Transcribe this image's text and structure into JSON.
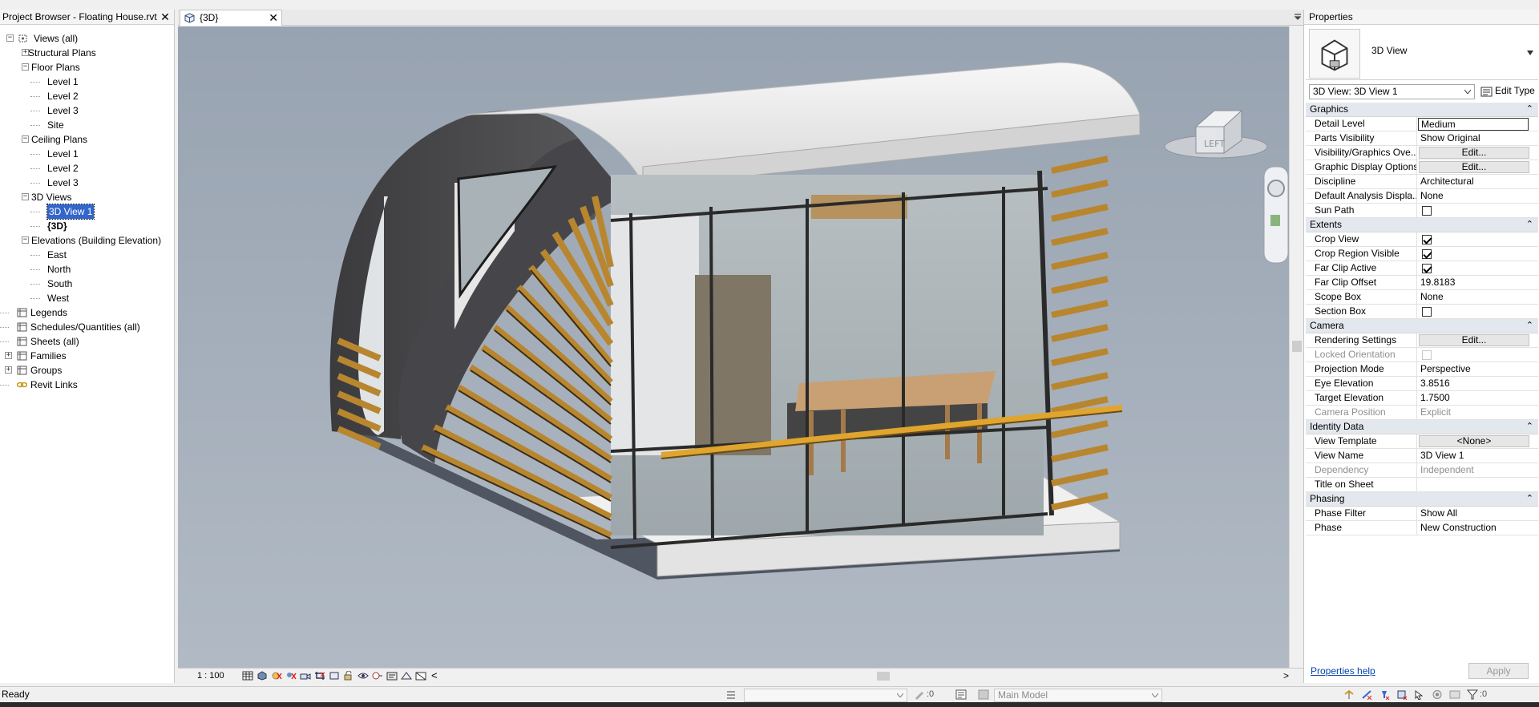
{
  "project_browser": {
    "title": "Project Browser - Floating House.rvt",
    "close": "✕",
    "items": [
      {
        "label": "Views (all)",
        "toggle": "−"
      },
      {
        "label": "Structural Plans",
        "toggle": "+"
      },
      {
        "label": "Floor Plans",
        "toggle": "−"
      },
      {
        "label": "Level 1"
      },
      {
        "label": "Level 2"
      },
      {
        "label": "Level 3"
      },
      {
        "label": "Site"
      },
      {
        "label": "Ceiling Plans",
        "toggle": "−"
      },
      {
        "label": "Level 1"
      },
      {
        "label": "Level 2"
      },
      {
        "label": "Level 3"
      },
      {
        "label": "3D Views",
        "toggle": "−"
      },
      {
        "label": "3D View 1",
        "selected": true
      },
      {
        "label": "{3D}",
        "bold": true
      },
      {
        "label": "Elevations (Building Elevation)",
        "toggle": "−"
      },
      {
        "label": "East"
      },
      {
        "label": "North"
      },
      {
        "label": "South"
      },
      {
        "label": "West"
      },
      {
        "label": "Legends",
        "icon": "legend-icon"
      },
      {
        "label": "Schedules/Quantities (all)",
        "icon": "schedule-icon"
      },
      {
        "label": "Sheets (all)",
        "icon": "sheet-icon"
      },
      {
        "label": "Families",
        "toggle": "+",
        "icon": "family-icon"
      },
      {
        "label": "Groups",
        "toggle": "+",
        "icon": "group-icon"
      },
      {
        "label": "Revit Links",
        "icon": "link-icon"
      }
    ]
  },
  "view_tab": {
    "label": "{3D}",
    "close": "✕"
  },
  "viewcube": {
    "face_label": "LEFT"
  },
  "view_control": {
    "scale": "1 : 100",
    "collapse": "<",
    "scroll_right": ">"
  },
  "properties": {
    "title": "Properties",
    "type_name": "3D View",
    "instance_selector": "3D View: 3D View 1",
    "edit_type": "Edit Type",
    "sections": [
      {
        "name": "Graphics",
        "rows": [
          {
            "label": "Detail Level",
            "value": "Medium",
            "kind": "box"
          },
          {
            "label": "Parts Visibility",
            "value": "Show Original"
          },
          {
            "label": "Visibility/Graphics Ove...",
            "value": "Edit...",
            "kind": "button"
          },
          {
            "label": "Graphic Display Options",
            "value": "Edit...",
            "kind": "button"
          },
          {
            "label": "Discipline",
            "value": "Architectural"
          },
          {
            "label": "Default Analysis Displa...",
            "value": "None"
          },
          {
            "label": "Sun Path",
            "checked": false,
            "kind": "check"
          }
        ]
      },
      {
        "name": "Extents",
        "rows": [
          {
            "label": "Crop View",
            "checked": true,
            "kind": "check"
          },
          {
            "label": "Crop Region Visible",
            "checked": true,
            "kind": "check"
          },
          {
            "label": "Far Clip Active",
            "checked": true,
            "kind": "check"
          },
          {
            "label": "Far Clip Offset",
            "value": "19.8183"
          },
          {
            "label": "Scope Box",
            "value": "None"
          },
          {
            "label": "Section Box",
            "checked": false,
            "kind": "check"
          }
        ]
      },
      {
        "name": "Camera",
        "rows": [
          {
            "label": "Rendering Settings",
            "value": "Edit...",
            "kind": "button"
          },
          {
            "label": "Locked Orientation",
            "checked": false,
            "kind": "check",
            "disabled": true
          },
          {
            "label": "Projection Mode",
            "value": "Perspective"
          },
          {
            "label": "Eye Elevation",
            "value": "3.8516"
          },
          {
            "label": "Target Elevation",
            "value": "1.7500"
          },
          {
            "label": "Camera Position",
            "value": "Explicit",
            "disabled": true
          }
        ]
      },
      {
        "name": "Identity Data",
        "rows": [
          {
            "label": "View Template",
            "value": "<None>",
            "kind": "button"
          },
          {
            "label": "View Name",
            "value": "3D View 1"
          },
          {
            "label": "Dependency",
            "value": "Independent",
            "disabled": true
          },
          {
            "label": "Title on Sheet",
            "value": ""
          }
        ]
      },
      {
        "name": "Phasing",
        "rows": [
          {
            "label": "Phase Filter",
            "value": "Show All"
          },
          {
            "label": "Phase",
            "value": "New Construction"
          }
        ]
      }
    ],
    "help_link": "Properties help",
    "apply": "Apply"
  },
  "status_bar": {
    "text": "Ready",
    "workset_value": "",
    "design_options_count": ":0",
    "model_combo": "Main Model",
    "filter_count": ":0"
  },
  "colors": {
    "viewport_top": "#98a3b1",
    "viewport_bottom": "#b1bac4",
    "selection": "#3366cc",
    "wood": "#b8862f",
    "handrail": "#e0a52e"
  }
}
